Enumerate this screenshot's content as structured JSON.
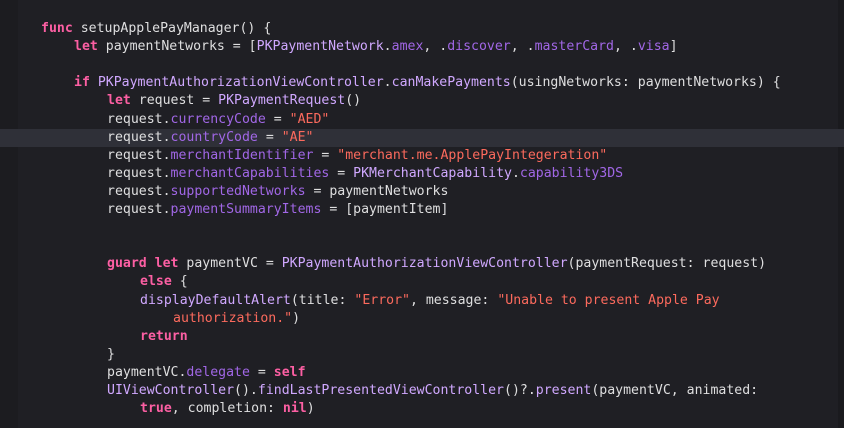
{
  "editor": {
    "highlighted_line": 6,
    "colors": {
      "background": "#1f1f24",
      "current_line": "#2f3038",
      "keyword": "#fc5fa3",
      "plain": "#dfdfe0",
      "type": "#d0a8ff",
      "property": "#a167e6",
      "string": "#fc6a5d"
    },
    "lines": [
      {
        "indent": 4,
        "tokens": [
          {
            "c": "kw",
            "t": "func"
          },
          {
            "c": "pl",
            "t": " setupApplePayManager() {"
          }
        ]
      },
      {
        "indent": 8,
        "tokens": [
          {
            "c": "kw",
            "t": "let"
          },
          {
            "c": "pl",
            "t": " paymentNetworks = ["
          },
          {
            "c": "ty",
            "t": "PKPaymentNetwork"
          },
          {
            "c": "pl",
            "t": "."
          },
          {
            "c": "prop",
            "t": "amex"
          },
          {
            "c": "pl",
            "t": ", ."
          },
          {
            "c": "prop",
            "t": "discover"
          },
          {
            "c": "pl",
            "t": ", ."
          },
          {
            "c": "prop",
            "t": "masterCard"
          },
          {
            "c": "pl",
            "t": ", ."
          },
          {
            "c": "prop",
            "t": "visa"
          },
          {
            "c": "pl",
            "t": "]"
          }
        ]
      },
      {
        "indent": 0,
        "tokens": []
      },
      {
        "indent": 8,
        "tokens": [
          {
            "c": "kw",
            "t": "if"
          },
          {
            "c": "pl",
            "t": " "
          },
          {
            "c": "ty",
            "t": "PKPaymentAuthorizationViewController"
          },
          {
            "c": "pl",
            "t": "."
          },
          {
            "c": "fn",
            "t": "canMakePayments"
          },
          {
            "c": "pl",
            "t": "(usingNetworks: paymentNetworks) {"
          }
        ]
      },
      {
        "indent": 12,
        "tokens": [
          {
            "c": "kw",
            "t": "let"
          },
          {
            "c": "pl",
            "t": " request = "
          },
          {
            "c": "ty",
            "t": "PKPaymentRequest"
          },
          {
            "c": "pl",
            "t": "()"
          }
        ]
      },
      {
        "indent": 12,
        "tokens": [
          {
            "c": "pl",
            "t": "request."
          },
          {
            "c": "prop",
            "t": "currencyCode"
          },
          {
            "c": "pl",
            "t": " = "
          },
          {
            "c": "str",
            "t": "\"AED\""
          }
        ]
      },
      {
        "indent": 12,
        "tokens": [
          {
            "c": "pl",
            "t": "request."
          },
          {
            "c": "prop",
            "t": "countryCode"
          },
          {
            "c": "pl",
            "t": " = "
          },
          {
            "c": "str",
            "t": "\"AE\""
          }
        ]
      },
      {
        "indent": 12,
        "tokens": [
          {
            "c": "pl",
            "t": "request."
          },
          {
            "c": "prop",
            "t": "merchantIdentifier"
          },
          {
            "c": "pl",
            "t": " = "
          },
          {
            "c": "str",
            "t": "\"merchant.me.ApplePayIntegeration\""
          }
        ]
      },
      {
        "indent": 12,
        "tokens": [
          {
            "c": "pl",
            "t": "request."
          },
          {
            "c": "prop",
            "t": "merchantCapabilities"
          },
          {
            "c": "pl",
            "t": " = "
          },
          {
            "c": "ty",
            "t": "PKMerchantCapability"
          },
          {
            "c": "pl",
            "t": "."
          },
          {
            "c": "prop",
            "t": "capability3DS"
          }
        ]
      },
      {
        "indent": 12,
        "tokens": [
          {
            "c": "pl",
            "t": "request."
          },
          {
            "c": "prop",
            "t": "supportedNetworks"
          },
          {
            "c": "pl",
            "t": " = paymentNetworks"
          }
        ]
      },
      {
        "indent": 12,
        "tokens": [
          {
            "c": "pl",
            "t": "request."
          },
          {
            "c": "prop",
            "t": "paymentSummaryItems"
          },
          {
            "c": "pl",
            "t": " = [paymentItem]"
          }
        ]
      },
      {
        "indent": 0,
        "tokens": []
      },
      {
        "indent": 0,
        "tokens": []
      },
      {
        "indent": 12,
        "tokens": [
          {
            "c": "kw",
            "t": "guard"
          },
          {
            "c": "pl",
            "t": " "
          },
          {
            "c": "kw",
            "t": "let"
          },
          {
            "c": "pl",
            "t": " paymentVC = "
          },
          {
            "c": "ty",
            "t": "PKPaymentAuthorizationViewController"
          },
          {
            "c": "pl",
            "t": "(paymentRequest: request)"
          }
        ]
      },
      {
        "indent": 16,
        "tokens": [
          {
            "c": "kw",
            "t": "else"
          },
          {
            "c": "pl",
            "t": " {"
          }
        ]
      },
      {
        "indent": 16,
        "tokens": [
          {
            "c": "fn",
            "t": "displayDefaultAlert"
          },
          {
            "c": "pl",
            "t": "(title: "
          },
          {
            "c": "str",
            "t": "\"Error\""
          },
          {
            "c": "pl",
            "t": ", message: "
          },
          {
            "c": "str",
            "t": "\"Unable to present Apple Pay"
          }
        ]
      },
      {
        "indent": 20,
        "tokens": [
          {
            "c": "str",
            "t": "authorization.\""
          },
          {
            "c": "pl",
            "t": ")"
          }
        ]
      },
      {
        "indent": 16,
        "tokens": [
          {
            "c": "kw",
            "t": "return"
          }
        ]
      },
      {
        "indent": 12,
        "tokens": [
          {
            "c": "pl",
            "t": "}"
          }
        ]
      },
      {
        "indent": 12,
        "tokens": [
          {
            "c": "pl",
            "t": "paymentVC."
          },
          {
            "c": "prop",
            "t": "delegate"
          },
          {
            "c": "pl",
            "t": " = "
          },
          {
            "c": "kw",
            "t": "self"
          }
        ]
      },
      {
        "indent": 12,
        "tokens": [
          {
            "c": "ty",
            "t": "UIViewController"
          },
          {
            "c": "pl",
            "t": "()."
          },
          {
            "c": "fn",
            "t": "findLastPresentedViewController"
          },
          {
            "c": "pl",
            "t": "()?."
          },
          {
            "c": "fn",
            "t": "present"
          },
          {
            "c": "pl",
            "t": "(paymentVC, animated:"
          }
        ]
      },
      {
        "indent": 16,
        "tokens": [
          {
            "c": "kw",
            "t": "true"
          },
          {
            "c": "pl",
            "t": ", completion: "
          },
          {
            "c": "kw",
            "t": "nil"
          },
          {
            "c": "pl",
            "t": ")"
          }
        ]
      }
    ]
  }
}
